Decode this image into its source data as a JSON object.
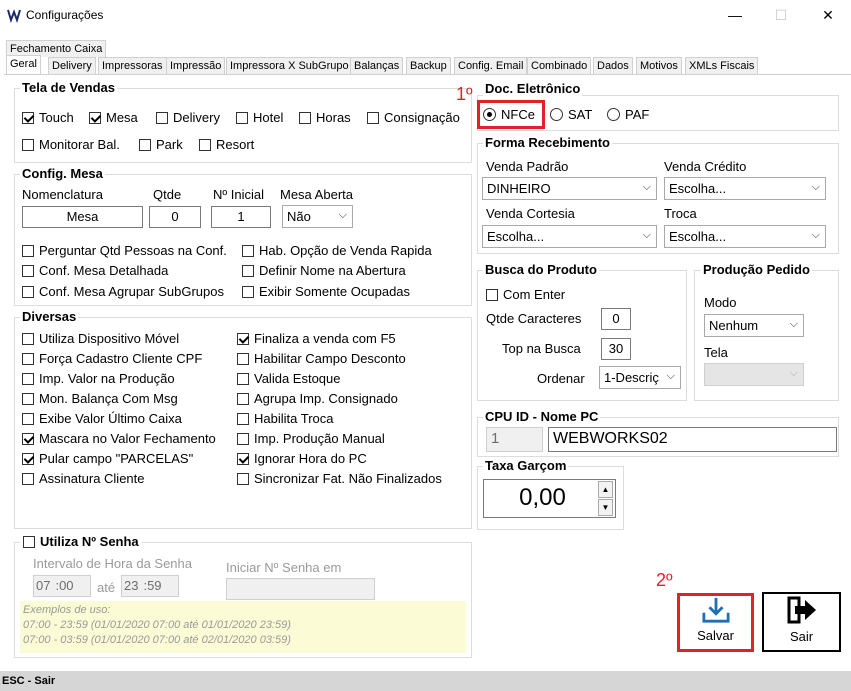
{
  "window": {
    "title": "Configurações",
    "minimize": "—",
    "maximize": "☐",
    "close": "✕"
  },
  "tabs_row1": [
    "Fechamento Caixa"
  ],
  "tabs_row2": [
    "Geral",
    "Delivery",
    "Impressoras",
    "Impressão",
    "Impressora X SubGrupo",
    "Balanças",
    "Backup",
    "Config. Email",
    "Combinado",
    "Dados",
    "Motivos",
    "XMLs Fiscais"
  ],
  "tela_vendas": {
    "title": "Tela de Vendas",
    "options": [
      {
        "label": "Touch",
        "checked": true
      },
      {
        "label": "Mesa",
        "checked": true
      },
      {
        "label": "Delivery",
        "checked": false
      },
      {
        "label": "Hotel",
        "checked": false
      },
      {
        "label": "Horas",
        "checked": false
      },
      {
        "label": "Consignação",
        "checked": false
      },
      {
        "label": "Monitorar Bal.",
        "checked": false
      },
      {
        "label": "Park",
        "checked": false
      },
      {
        "label": "Resort",
        "checked": false
      }
    ]
  },
  "config_mesa": {
    "title": "Config. Mesa",
    "nomenclatura_label": "Nomenclatura",
    "nomenclatura_value": "Mesa",
    "qtde_label": "Qtde",
    "qtde_value": "0",
    "inicial_label": "Nº Inicial",
    "inicial_value": "1",
    "aberta_label": "Mesa Aberta",
    "aberta_value": "Não",
    "options": [
      {
        "label": "Perguntar Qtd Pessoas na Conf.",
        "checked": false
      },
      {
        "label": "Hab. Opção de Venda Rapida",
        "checked": false
      },
      {
        "label": "Conf. Mesa Detalhada",
        "checked": false
      },
      {
        "label": "Definir Nome na Abertura",
        "checked": false
      },
      {
        "label": "Conf. Mesa Agrupar SubGrupos",
        "checked": false
      },
      {
        "label": "Exibir Somente Ocupadas",
        "checked": false
      }
    ]
  },
  "diversas": {
    "title": "Diversas",
    "left": [
      {
        "label": "Utiliza Dispositivo Móvel",
        "checked": false
      },
      {
        "label": "Força Cadastro Cliente CPF",
        "checked": false
      },
      {
        "label": "Imp. Valor na Produção",
        "checked": false
      },
      {
        "label": "Mon. Balança Com Msg",
        "checked": false
      },
      {
        "label": "Exibe Valor Último Caixa",
        "checked": false
      },
      {
        "label": "Mascara no Valor Fechamento",
        "checked": true
      },
      {
        "label": "Pular campo \"PARCELAS\"",
        "checked": true
      },
      {
        "label": "Assinatura Cliente",
        "checked": false
      }
    ],
    "right": [
      {
        "label": "Finaliza a venda com F5",
        "checked": true
      },
      {
        "label": "Habilitar Campo Desconto",
        "checked": false
      },
      {
        "label": "Valida Estoque",
        "checked": false
      },
      {
        "label": "Agrupa Imp. Consignado",
        "checked": false
      },
      {
        "label": "Habilita Troca",
        "checked": false
      },
      {
        "label": "Imp. Produção Manual",
        "checked": false
      },
      {
        "label": "Ignorar Hora do PC",
        "checked": true
      },
      {
        "label": "Sincronizar Fat. Não Finalizados",
        "checked": false
      }
    ]
  },
  "senha": {
    "title": "Utiliza Nº Senha",
    "intervalo_label": "Intervalo de Hora da Senha",
    "from_h": "07",
    "from_m": ":00",
    "ate": "até",
    "to_h": "23",
    "to_m": ":59",
    "iniciar_label": "Iniciar Nº Senha em",
    "iniciar_value": "",
    "exemplos_title": "Exemplos de uso:",
    "exemplo1": "07:00 - 23:59 (01/01/2020 07:00 até 01/01/2020 23:59)",
    "exemplo2": "07:00 - 03:59 (01/01/2020 07:00 até 02/01/2020 03:59)"
  },
  "doc_eletronico": {
    "title": "Doc. Eletrônico",
    "options": [
      {
        "label": "NFCe",
        "checked": true
      },
      {
        "label": "SAT",
        "checked": false
      },
      {
        "label": "PAF",
        "checked": false
      }
    ]
  },
  "forma_recebimento": {
    "title": "Forma Recebimento",
    "venda_padrao_label": "Venda Padrão",
    "venda_padrao_value": "DINHEIRO",
    "venda_credito_label": "Venda Crédito",
    "venda_credito_value": "Escolha...",
    "venda_cortesia_label": "Venda Cortesia",
    "venda_cortesia_value": "Escolha...",
    "troca_label": "Troca",
    "troca_value": "Escolha..."
  },
  "busca_produto": {
    "title": "Busca do Produto",
    "com_enter": "Com Enter",
    "qtde_caracteres_label": "Qtde Caracteres",
    "qtde_caracteres_value": "0",
    "top_busca_label": "Top na Busca",
    "top_busca_value": "30",
    "ordenar_label": "Ordenar",
    "ordenar_value": "1-Descriç"
  },
  "producao_pedido": {
    "title": "Produção Pedido",
    "modo_label": "Modo",
    "modo_value": "Nenhum",
    "tela_label": "Tela",
    "tela_value": ""
  },
  "cpu": {
    "title": "CPU ID - Nome PC",
    "id": "1",
    "name": "WEBWORKS02"
  },
  "taxa": {
    "title": "Taxa Garçom",
    "value": "0,00"
  },
  "annotations": {
    "step1": "1º",
    "step2": "2º"
  },
  "buttons": {
    "salvar": "Salvar",
    "sair": "Sair"
  },
  "status": "ESC - Sair",
  "colors": {
    "highlight_red": "#e0232a",
    "salvar_icon": "#1f6fb5"
  }
}
